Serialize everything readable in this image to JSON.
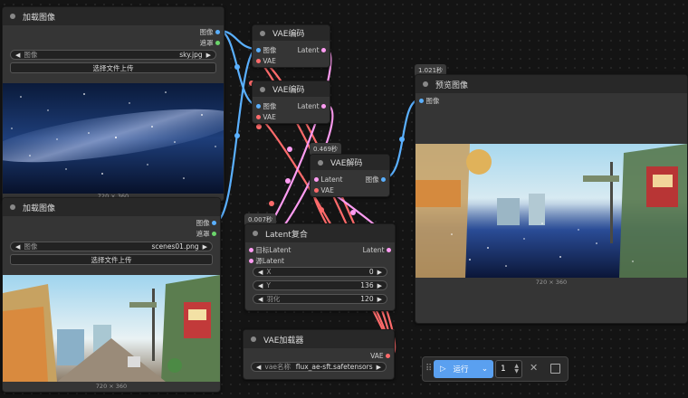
{
  "load_image_1": {
    "title": "加载图像",
    "out_image": "图像",
    "out_mask": "遮罩",
    "image_label": "图像",
    "image_value": "sky.jpg",
    "upload_label": "选择文件上传",
    "dim": "720 × 360"
  },
  "load_image_2": {
    "title": "加载图像",
    "out_image": "图像",
    "out_mask": "遮罩",
    "image_label": "图像",
    "image_value": "scenes01.png",
    "upload_label": "选择文件上传",
    "dim": "720 × 360"
  },
  "vae_encode_1": {
    "title": "VAE编码",
    "in_image": "图像",
    "in_vae": "VAE",
    "out_latent": "Latent"
  },
  "vae_encode_2": {
    "title": "VAE编码",
    "in_image": "图像",
    "in_vae": "VAE",
    "out_latent": "Latent"
  },
  "vae_decode": {
    "badge": "0.469秒",
    "title": "VAE解码",
    "in_latent": "Latent",
    "in_vae": "VAE",
    "out_image": "图像"
  },
  "latent_composite": {
    "badge": "0.007秒",
    "title": "Latent复合",
    "in_target": "目标Latent",
    "in_source": "源Latent",
    "out_latent": "Latent",
    "x_label": "X",
    "x_value": "0",
    "y_label": "Y",
    "y_value": "136",
    "feather_label": "羽化",
    "feather_value": "120"
  },
  "vae_loader": {
    "title": "VAE加载器",
    "out_vae": "VAE",
    "name_label": "vae名称",
    "name_value": "flux_ae-sft.safetensors"
  },
  "preview": {
    "badge": "1.021秒",
    "title": "预览图像",
    "in_image": "图像",
    "dim": "720 × 360"
  },
  "toolbar": {
    "run_label": "运行",
    "count": "1"
  },
  "colors": {
    "image": "#5ab0ff",
    "mask": "#6bd66b",
    "vae": "#ff6b6b",
    "latent": "#ff9cf2"
  }
}
